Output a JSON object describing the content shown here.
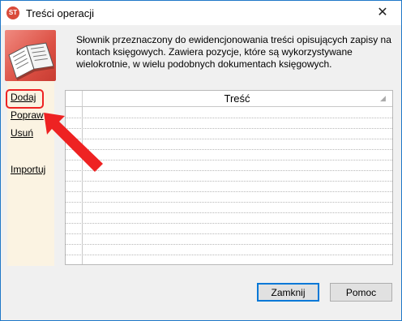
{
  "window": {
    "title": "Treści operacji",
    "close_glyph": "✕",
    "app_icon_text": "ST",
    "app_icon_color": "#d94b3a"
  },
  "sidebar": {
    "image_icon": "book-icon",
    "actions": [
      {
        "label": "Dodaj",
        "highlighted": true
      },
      {
        "label": "Popraw"
      },
      {
        "label": "Usuń"
      },
      {
        "label": "Importuj"
      }
    ]
  },
  "description": "Słownik przeznaczony do ewidencjonowania treści opisujących zapisy na kontach księgowych. Zawiera pozycje, które są wykorzystywane wielokrotnie, w wielu podobnych dokumentach księgowych.",
  "grid": {
    "columns": [
      {
        "label": "Treść",
        "sortable": true
      }
    ],
    "rows": []
  },
  "buttons": {
    "close_label": "Zamknij",
    "help_label": "Pomoc"
  },
  "colors": {
    "highlight": "#ee2222",
    "sidebar_bg": "#fbf3e2",
    "accent": "#0078d7"
  }
}
